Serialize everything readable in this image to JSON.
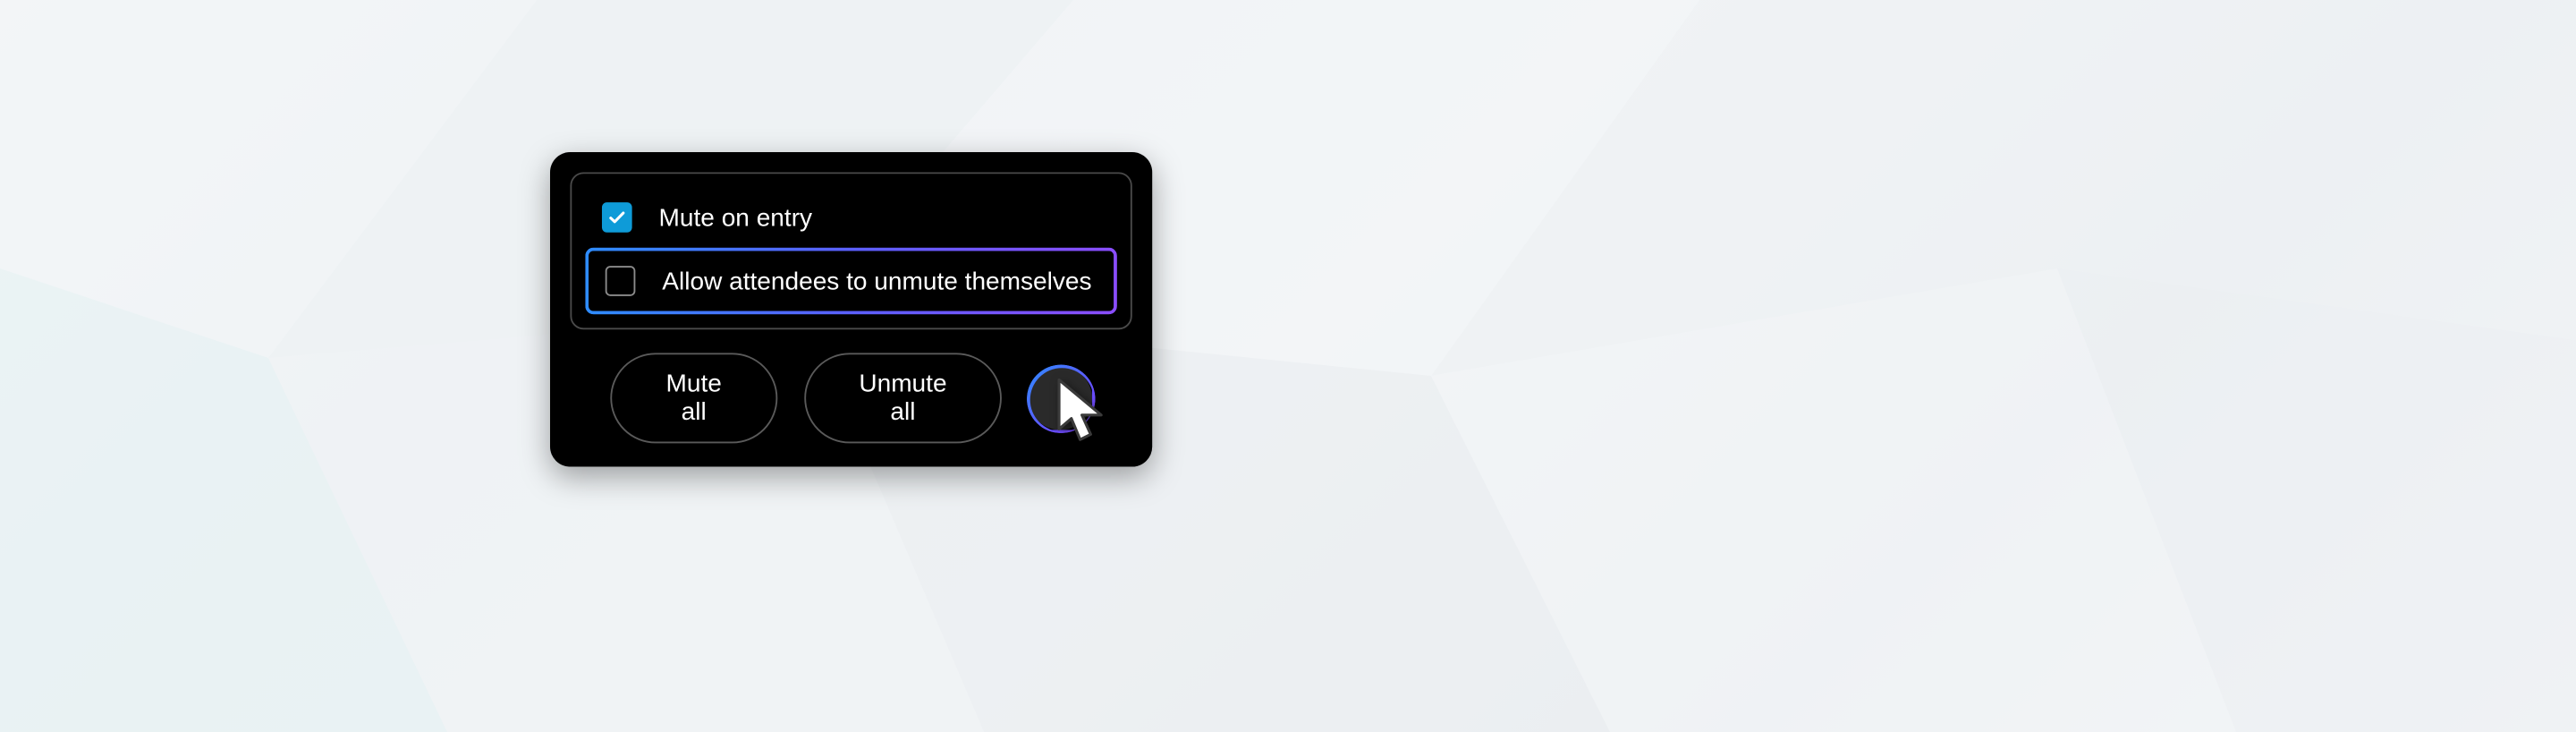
{
  "options": {
    "mute_on_entry": {
      "label": "Mute  on entry",
      "checked": true
    },
    "allow_unmute": {
      "label": "Allow attendees to unmute themselves",
      "checked": false,
      "highlighted": true
    }
  },
  "buttons": {
    "mute_all": "Mute all",
    "unmute_all": "Unmute all"
  },
  "icons": {
    "more": "more-options"
  },
  "colors": {
    "checkbox_checked_bg": "#0e9bd8",
    "gradient_start": "#2e8cff",
    "gradient_end": "#8a4dff",
    "panel_bg": "#000000"
  }
}
